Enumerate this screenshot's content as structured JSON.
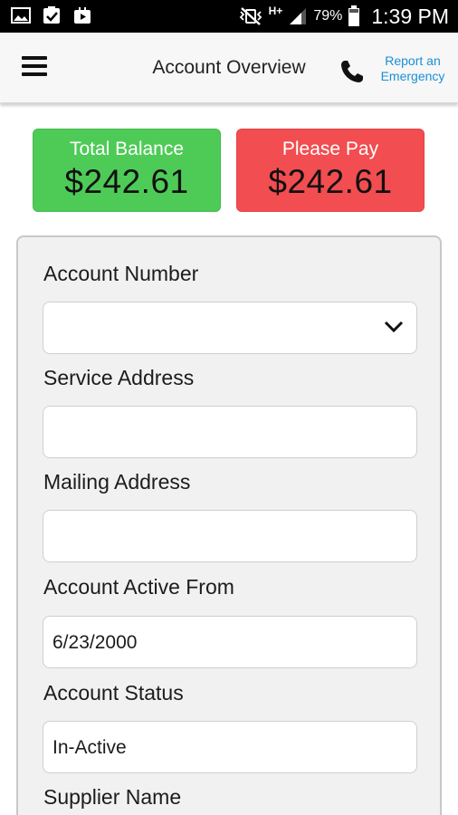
{
  "status_bar": {
    "icons": [
      "gallery-icon",
      "clipboard-check-icon",
      "video-icon",
      "mute-vibrate-icon",
      "hplus-data-icon",
      "signal-icon",
      "battery-icon"
    ],
    "network": "H+",
    "battery": "79%",
    "time": "1:39 PM"
  },
  "header": {
    "title": "Account Overview",
    "report_line1": "Report an",
    "report_line2": "Emergency",
    "accent_color": "#1a8fd6"
  },
  "balances": {
    "total_label": "Total Balance",
    "total_amount": "$242.61",
    "total_color": "#4ecb57",
    "pay_label": "Please Pay",
    "pay_amount": "$242.61",
    "pay_color": "#f24d50"
  },
  "form": {
    "account_number_label": "Account Number",
    "account_number_value": "",
    "service_address_label": "Service Address",
    "service_address_value": "",
    "mailing_address_label": "Mailing Address",
    "mailing_address_value": "",
    "active_from_label": "Account Active From",
    "active_from_value": "6/23/2000",
    "status_label": "Account Status",
    "status_value": "In-Active",
    "supplier_label": "Supplier Name"
  }
}
